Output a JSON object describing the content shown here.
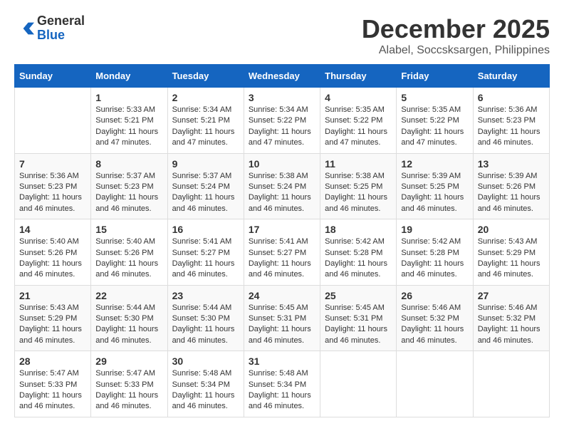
{
  "logo": {
    "general": "General",
    "blue": "Blue"
  },
  "title": "December 2025",
  "subtitle": "Alabel, Soccsksargen, Philippines",
  "headers": [
    "Sunday",
    "Monday",
    "Tuesday",
    "Wednesday",
    "Thursday",
    "Friday",
    "Saturday"
  ],
  "weeks": [
    [
      {
        "day": "",
        "info": ""
      },
      {
        "day": "1",
        "info": "Sunrise: 5:33 AM\nSunset: 5:21 PM\nDaylight: 11 hours and 47 minutes."
      },
      {
        "day": "2",
        "info": "Sunrise: 5:34 AM\nSunset: 5:21 PM\nDaylight: 11 hours and 47 minutes."
      },
      {
        "day": "3",
        "info": "Sunrise: 5:34 AM\nSunset: 5:22 PM\nDaylight: 11 hours and 47 minutes."
      },
      {
        "day": "4",
        "info": "Sunrise: 5:35 AM\nSunset: 5:22 PM\nDaylight: 11 hours and 47 minutes."
      },
      {
        "day": "5",
        "info": "Sunrise: 5:35 AM\nSunset: 5:22 PM\nDaylight: 11 hours and 47 minutes."
      },
      {
        "day": "6",
        "info": "Sunrise: 5:36 AM\nSunset: 5:23 PM\nDaylight: 11 hours and 46 minutes."
      }
    ],
    [
      {
        "day": "7",
        "info": "Sunrise: 5:36 AM\nSunset: 5:23 PM\nDaylight: 11 hours and 46 minutes."
      },
      {
        "day": "8",
        "info": "Sunrise: 5:37 AM\nSunset: 5:23 PM\nDaylight: 11 hours and 46 minutes."
      },
      {
        "day": "9",
        "info": "Sunrise: 5:37 AM\nSunset: 5:24 PM\nDaylight: 11 hours and 46 minutes."
      },
      {
        "day": "10",
        "info": "Sunrise: 5:38 AM\nSunset: 5:24 PM\nDaylight: 11 hours and 46 minutes."
      },
      {
        "day": "11",
        "info": "Sunrise: 5:38 AM\nSunset: 5:25 PM\nDaylight: 11 hours and 46 minutes."
      },
      {
        "day": "12",
        "info": "Sunrise: 5:39 AM\nSunset: 5:25 PM\nDaylight: 11 hours and 46 minutes."
      },
      {
        "day": "13",
        "info": "Sunrise: 5:39 AM\nSunset: 5:26 PM\nDaylight: 11 hours and 46 minutes."
      }
    ],
    [
      {
        "day": "14",
        "info": "Sunrise: 5:40 AM\nSunset: 5:26 PM\nDaylight: 11 hours and 46 minutes."
      },
      {
        "day": "15",
        "info": "Sunrise: 5:40 AM\nSunset: 5:26 PM\nDaylight: 11 hours and 46 minutes."
      },
      {
        "day": "16",
        "info": "Sunrise: 5:41 AM\nSunset: 5:27 PM\nDaylight: 11 hours and 46 minutes."
      },
      {
        "day": "17",
        "info": "Sunrise: 5:41 AM\nSunset: 5:27 PM\nDaylight: 11 hours and 46 minutes."
      },
      {
        "day": "18",
        "info": "Sunrise: 5:42 AM\nSunset: 5:28 PM\nDaylight: 11 hours and 46 minutes."
      },
      {
        "day": "19",
        "info": "Sunrise: 5:42 AM\nSunset: 5:28 PM\nDaylight: 11 hours and 46 minutes."
      },
      {
        "day": "20",
        "info": "Sunrise: 5:43 AM\nSunset: 5:29 PM\nDaylight: 11 hours and 46 minutes."
      }
    ],
    [
      {
        "day": "21",
        "info": "Sunrise: 5:43 AM\nSunset: 5:29 PM\nDaylight: 11 hours and 46 minutes."
      },
      {
        "day": "22",
        "info": "Sunrise: 5:44 AM\nSunset: 5:30 PM\nDaylight: 11 hours and 46 minutes."
      },
      {
        "day": "23",
        "info": "Sunrise: 5:44 AM\nSunset: 5:30 PM\nDaylight: 11 hours and 46 minutes."
      },
      {
        "day": "24",
        "info": "Sunrise: 5:45 AM\nSunset: 5:31 PM\nDaylight: 11 hours and 46 minutes."
      },
      {
        "day": "25",
        "info": "Sunrise: 5:45 AM\nSunset: 5:31 PM\nDaylight: 11 hours and 46 minutes."
      },
      {
        "day": "26",
        "info": "Sunrise: 5:46 AM\nSunset: 5:32 PM\nDaylight: 11 hours and 46 minutes."
      },
      {
        "day": "27",
        "info": "Sunrise: 5:46 AM\nSunset: 5:32 PM\nDaylight: 11 hours and 46 minutes."
      }
    ],
    [
      {
        "day": "28",
        "info": "Sunrise: 5:47 AM\nSunset: 5:33 PM\nDaylight: 11 hours and 46 minutes."
      },
      {
        "day": "29",
        "info": "Sunrise: 5:47 AM\nSunset: 5:33 PM\nDaylight: 11 hours and 46 minutes."
      },
      {
        "day": "30",
        "info": "Sunrise: 5:48 AM\nSunset: 5:34 PM\nDaylight: 11 hours and 46 minutes."
      },
      {
        "day": "31",
        "info": "Sunrise: 5:48 AM\nSunset: 5:34 PM\nDaylight: 11 hours and 46 minutes."
      },
      {
        "day": "",
        "info": ""
      },
      {
        "day": "",
        "info": ""
      },
      {
        "day": "",
        "info": ""
      }
    ]
  ]
}
